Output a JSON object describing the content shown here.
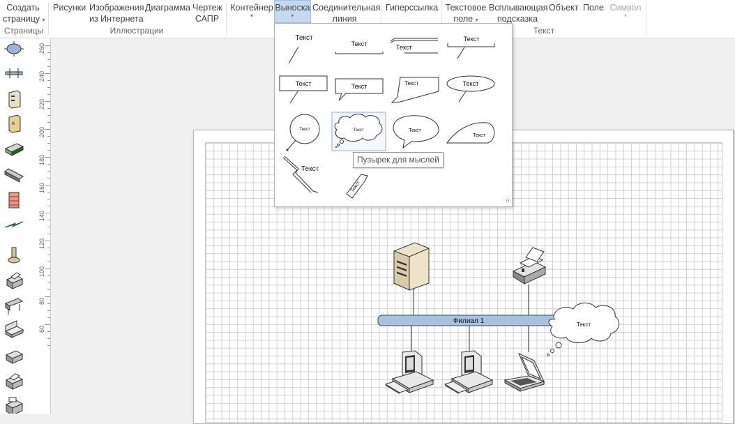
{
  "ribbon": {
    "create_page": "Создать страницу",
    "create_page_line1": "Создать",
    "create_page_line2": "страницу",
    "pictures": "Рисунки",
    "online_images_line1": "Изображения",
    "online_images_line2": "из Интернета",
    "chart": "Диаграмма",
    "cad_line1": "Чертеж",
    "cad_line2": "САПР",
    "container": "Контейнер",
    "callout": "Выноска",
    "connector_line1": "Соединительная",
    "connector_line2": "линия",
    "hyperlink": "Гиперссылка",
    "textbox_line1": "Текстовое",
    "textbox_line2": "поле",
    "screentip_line1": "Всплывающая",
    "screentip_line2": "подсказка",
    "object": "Объект",
    "field": "Поле",
    "symbol": "Символ",
    "groups": {
      "pages": "Страницы",
      "illustrations": "Иллюстрации",
      "text": "Текст"
    }
  },
  "callout_gallery": {
    "sample_text": "Текст",
    "items": [
      {
        "name": "callout-line"
      },
      {
        "name": "callout-bracket-line"
      },
      {
        "name": "callout-underline"
      },
      {
        "name": "callout-side-line"
      },
      {
        "name": "callout-rectangle"
      },
      {
        "name": "callout-speech-rectangle"
      },
      {
        "name": "callout-trapezoid"
      },
      {
        "name": "callout-oval"
      },
      {
        "name": "callout-circle"
      },
      {
        "name": "callout-thought-bubble"
      },
      {
        "name": "callout-speech-oval"
      },
      {
        "name": "callout-leaf"
      },
      {
        "name": "callout-zigzag"
      },
      {
        "name": "callout-tag"
      }
    ],
    "selected_index": 9,
    "tooltip": "Пузырек для мыслей"
  },
  "ruler": {
    "labels": [
      "260",
      "240",
      "220",
      "200",
      "180",
      "160",
      "140",
      "120",
      "100",
      "80",
      "60"
    ]
  },
  "diagram": {
    "bus_label": "Филиал 1",
    "thought_text": "Текст"
  },
  "stencil": {
    "shapes": [
      "ring-network-icon",
      "ethernet-icon",
      "server-icon",
      "tower-server-icon",
      "router-icon",
      "switch-icon",
      "firewall-icon",
      "lightning-bolt-icon",
      "tape-drive-icon",
      "printer-icon",
      "plotter-icon",
      "scanner-icon",
      "fax-icon",
      "copier-icon",
      "multifunction-icon"
    ]
  },
  "colors": {
    "active_tab": "#c5d9f1",
    "bus_fill": "#a8c2de",
    "grid_line": "#d0d0d0"
  }
}
